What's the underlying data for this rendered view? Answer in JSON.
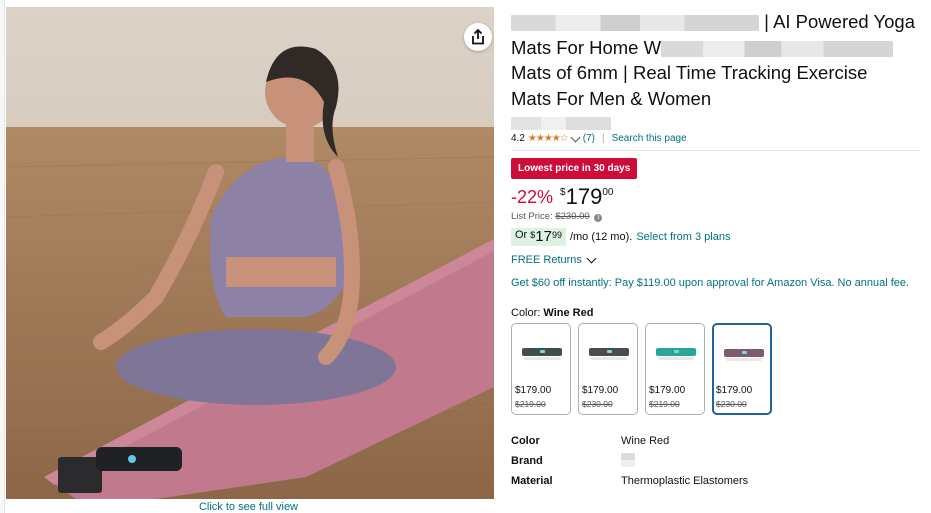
{
  "product": {
    "title_lines": [
      " | AI Powered Yoga",
      "Mats For Home W",
      "Mats of 6mm | Real Time Tracking Exercise",
      "Mats For Men & Women"
    ],
    "rating": "4.2",
    "stars": "★★★★☆",
    "review_count": "(7)",
    "search_link": "Search this page"
  },
  "pricing": {
    "deal_badge": "Lowest price in 30 days",
    "discount": "-22%",
    "currency": "$",
    "price_whole": "179",
    "price_fraction": "00",
    "list_price_label": "List Price:",
    "list_price": "$230.00",
    "info_icon": "i",
    "monthly_prefix": "Or",
    "monthly_whole": "17",
    "monthly_fraction": "99",
    "monthly_suffix": "/mo (12 mo).",
    "plans_link": "Select from 3 plans",
    "returns": "FREE Returns",
    "card_offer": "Get $60 off instantly: Pay $119.00 upon approval for Amazon Visa. No annual fee."
  },
  "variants": {
    "label": "Color:",
    "selected": "Wine Red",
    "options": [
      {
        "price": "$179.00",
        "list_price": "$219.00",
        "color": "#3f4f4c"
      },
      {
        "price": "$179.00",
        "list_price": "$230.00",
        "color": "#4a4c50"
      },
      {
        "price": "$179.00",
        "list_price": "$219.00",
        "color": "#2aa59a"
      },
      {
        "price": "$179.00",
        "list_price": "$230.00",
        "color": "#7d5a6e"
      }
    ]
  },
  "specs": [
    {
      "key": "Color",
      "value": "Wine Red"
    },
    {
      "key": "Brand",
      "value": ""
    },
    {
      "key": "Material",
      "value": "Thermoplastic Elastomers"
    }
  ],
  "gallery": {
    "full_view_link": "Click to see full view",
    "share_icon": "share-icon"
  },
  "colors": {
    "link": "#007185",
    "deal_red": "#cc0c39",
    "star": "#de7921",
    "selected_border": "#2162a1"
  }
}
